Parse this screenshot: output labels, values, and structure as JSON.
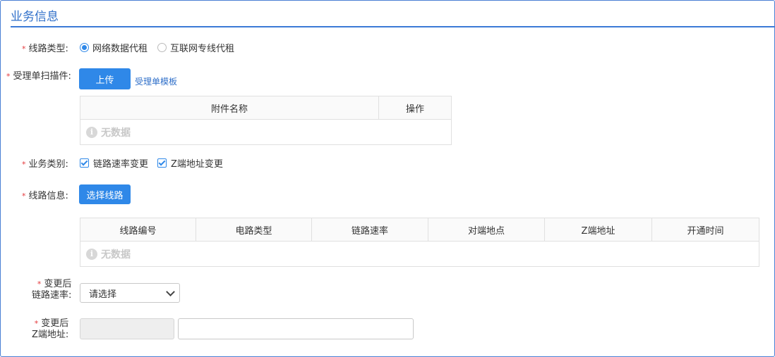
{
  "section_title": "业务信息",
  "line_type": {
    "label": "线路类型:",
    "options": [
      "网络数据代租",
      "互联网专线代租"
    ],
    "selected": "网络数据代租"
  },
  "scan": {
    "label": "受理单扫描件:",
    "upload_button": "上传",
    "template_link": "受理单模板",
    "columns": [
      "附件名称",
      "操作"
    ],
    "empty_text": "无数据"
  },
  "business_category": {
    "label": "业务类别:",
    "options": [
      {
        "label": "链路速率变更",
        "checked": true
      },
      {
        "label": "Z端地址变更",
        "checked": true
      }
    ]
  },
  "line_info": {
    "label": "线路信息:",
    "select_button": "选择线路",
    "columns": [
      "线路编号",
      "电路类型",
      "链路速率",
      "对端地点",
      "Z端地址",
      "开通时间"
    ],
    "empty_text": "无数据"
  },
  "new_rate": {
    "label_line1": "变更后",
    "label_line2": "链路速率:",
    "select_value": "请选择"
  },
  "new_address": {
    "label_line1": "变更后",
    "label_line2": "Z端地址:",
    "prefix_value": "",
    "detail_value": ""
  },
  "required_mark": "*",
  "colors": {
    "accent": "#2f88e8",
    "title": "#2f6fc9",
    "required": "#e4393c"
  }
}
